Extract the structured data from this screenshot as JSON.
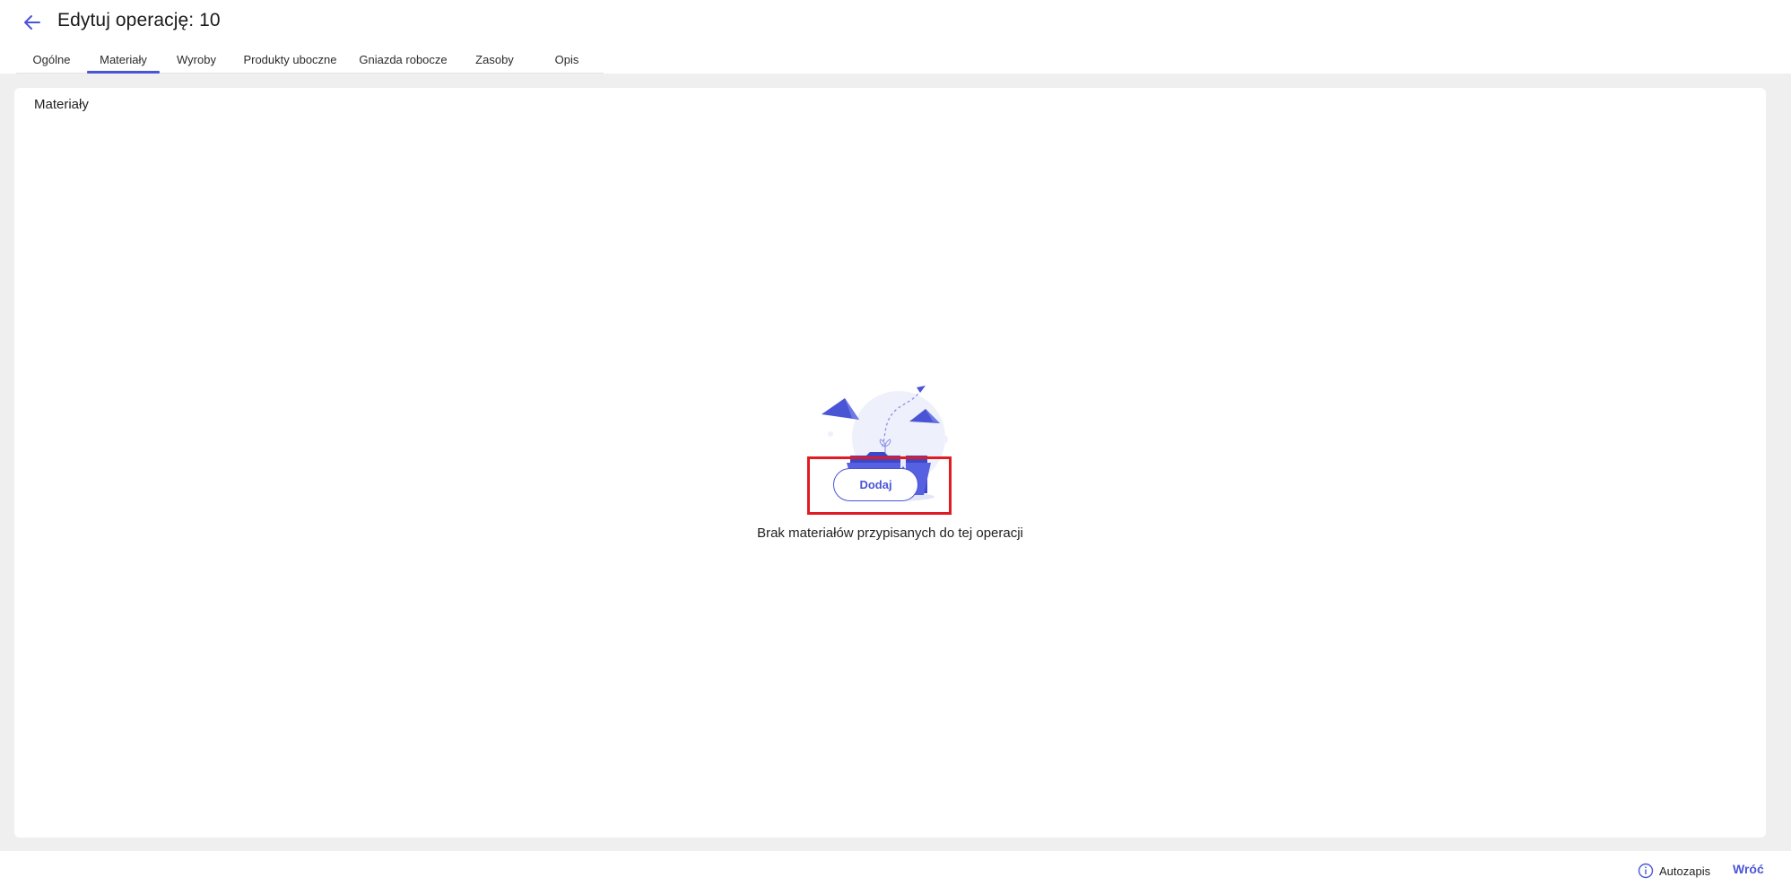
{
  "header": {
    "title": "Edytuj operację: 10"
  },
  "tabs": [
    {
      "label": "Ogólne",
      "active": false
    },
    {
      "label": "Materiały",
      "active": true
    },
    {
      "label": "Wyroby",
      "active": false
    },
    {
      "label": "Produkty uboczne",
      "active": false
    },
    {
      "label": "Gniazda robocze",
      "active": false
    },
    {
      "label": "Zasoby",
      "active": false
    },
    {
      "label": "Opis",
      "active": false
    }
  ],
  "card": {
    "title": "Materiały",
    "empty_message": "Brak materiałów przypisanych do tej operacji",
    "add_label": "Dodaj"
  },
  "footer": {
    "autosave_label": "Autozapis",
    "back_label": "Wróć"
  },
  "colors": {
    "accent": "#4a55d6",
    "highlight": "#e11b22",
    "content_background": "#efefef"
  },
  "icons": {
    "back": "arrow-left-icon",
    "info": "info-icon",
    "illustration": "empty-folder-illustration"
  }
}
